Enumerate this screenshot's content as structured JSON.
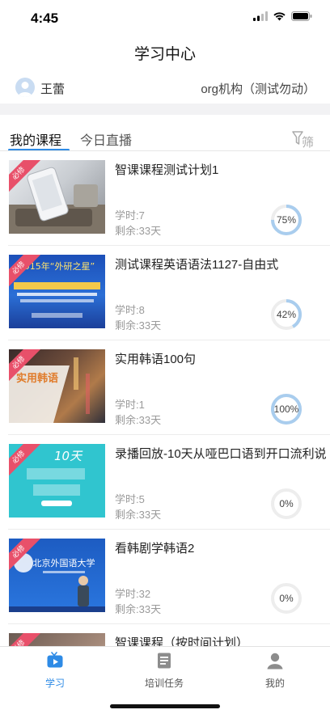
{
  "status_bar": {
    "time": "4:45"
  },
  "header": {
    "title": "学习中心"
  },
  "user": {
    "name": "王蕾",
    "org": "org机构（测试勿动）"
  },
  "tabs": [
    {
      "label": "我的课程",
      "active": true
    },
    {
      "label": "今日直播",
      "active": false
    }
  ],
  "filter_label": "筛",
  "badge_label": "必修",
  "courses": [
    {
      "title": "智课课程测试计划1",
      "hours": "学时:7",
      "remaining": "剩余:33天",
      "progress_label": "75%",
      "progress": 0.75,
      "thumb_text": ""
    },
    {
      "title": "测试课程英语语法1127-自由式",
      "hours": "学时:8",
      "remaining": "剩余:33天",
      "progress_label": "42%",
      "progress": 0.42,
      "thumb_text": "2015年“外研之星”"
    },
    {
      "title": "实用韩语100句",
      "hours": "学时:1",
      "remaining": "剩余:33天",
      "progress_label": "100%",
      "progress": 1.0,
      "thumb_text": "实用韩语"
    },
    {
      "title": "录播回放-10天从哑巴口语到开口流利说",
      "hours": "学时:5",
      "remaining": "剩余:33天",
      "progress_label": "0%",
      "progress": 0.0,
      "thumb_text": "10天"
    },
    {
      "title": "看韩剧学韩语2",
      "hours": "学时:32",
      "remaining": "剩余:33天",
      "progress_label": "0%",
      "progress": 0.0,
      "thumb_text": "北京外国语大学"
    },
    {
      "title": "智课课程（按时间计划）",
      "hours": "",
      "remaining": "",
      "progress_label": "",
      "progress": 0.0,
      "thumb_text": ""
    }
  ],
  "tabbar": [
    {
      "label": "学习",
      "icon": "tv-icon",
      "active": true
    },
    {
      "label": "培训任务",
      "icon": "document-icon",
      "active": false
    },
    {
      "label": "我的",
      "icon": "person-icon",
      "active": false
    }
  ],
  "colors": {
    "accent": "#2e8be6",
    "progress_fill": "#a9cdee",
    "progress_track": "#ededed",
    "badge": "#e8506a"
  }
}
